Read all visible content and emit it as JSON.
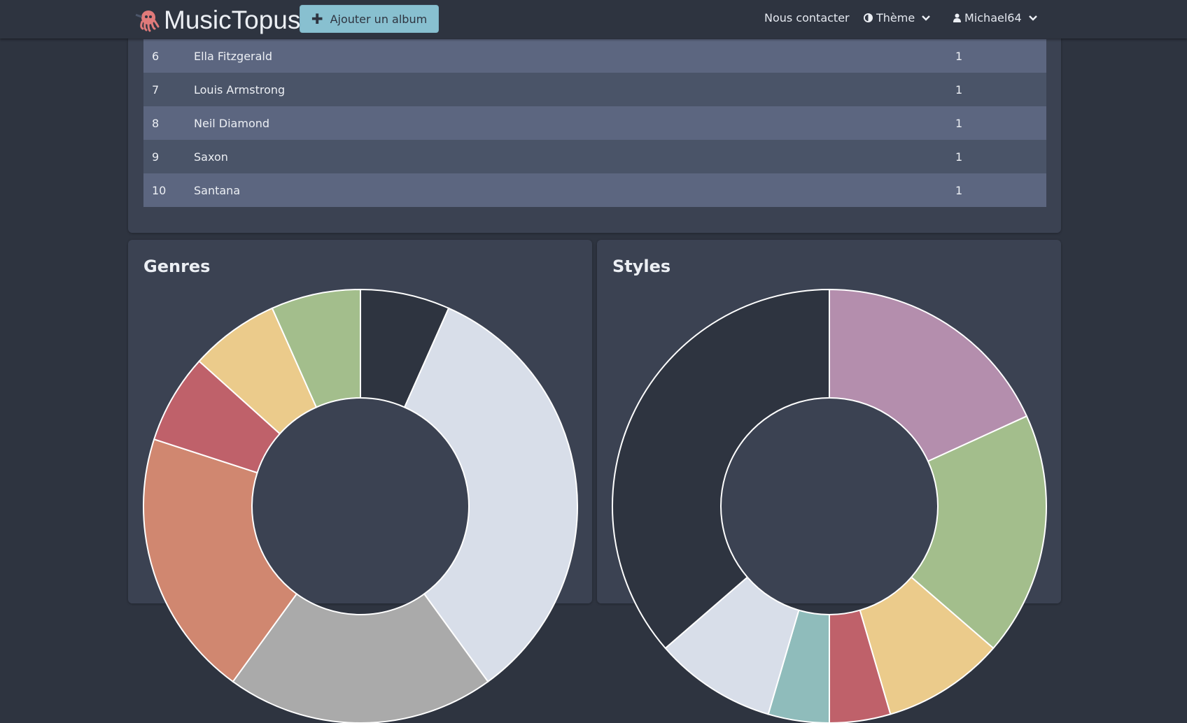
{
  "navbar": {
    "brand": "MusicTopus",
    "add_album_label": "Ajouter un album",
    "contact_label": "Nous contacter",
    "theme_label": "Thème",
    "user_label": "Michael64"
  },
  "top_artists": {
    "rows": [
      {
        "rank": "6",
        "artist": "Ella Fitzgerald",
        "count": "1"
      },
      {
        "rank": "7",
        "artist": "Louis Armstrong",
        "count": "1"
      },
      {
        "rank": "8",
        "artist": "Neil Diamond",
        "count": "1"
      },
      {
        "rank": "9",
        "artist": "Saxon",
        "count": "1"
      },
      {
        "rank": "10",
        "artist": "Santana",
        "count": "1"
      }
    ]
  },
  "genres": {
    "title": "Genres"
  },
  "styles": {
    "title": "Styles"
  },
  "chart_data": [
    {
      "type": "pie",
      "title": "Genres",
      "donut": true,
      "values": [
        1,
        5,
        3,
        3,
        1,
        1,
        1
      ],
      "colors": [
        "#2e3440",
        "#d8dee9",
        "#aaaaaa",
        "#d08770",
        "#bf616a",
        "#ebcb8b",
        "#a3be8c"
      ]
    },
    {
      "type": "pie",
      "title": "Styles",
      "donut": true,
      "values": [
        2,
        2,
        1,
        0.5,
        0.5,
        1,
        4
      ],
      "colors": [
        "#b48ead",
        "#a3be8c",
        "#ebcb8b",
        "#bf616a",
        "#8fbcbb",
        "#d8dee9",
        "#2e3440"
      ]
    }
  ]
}
